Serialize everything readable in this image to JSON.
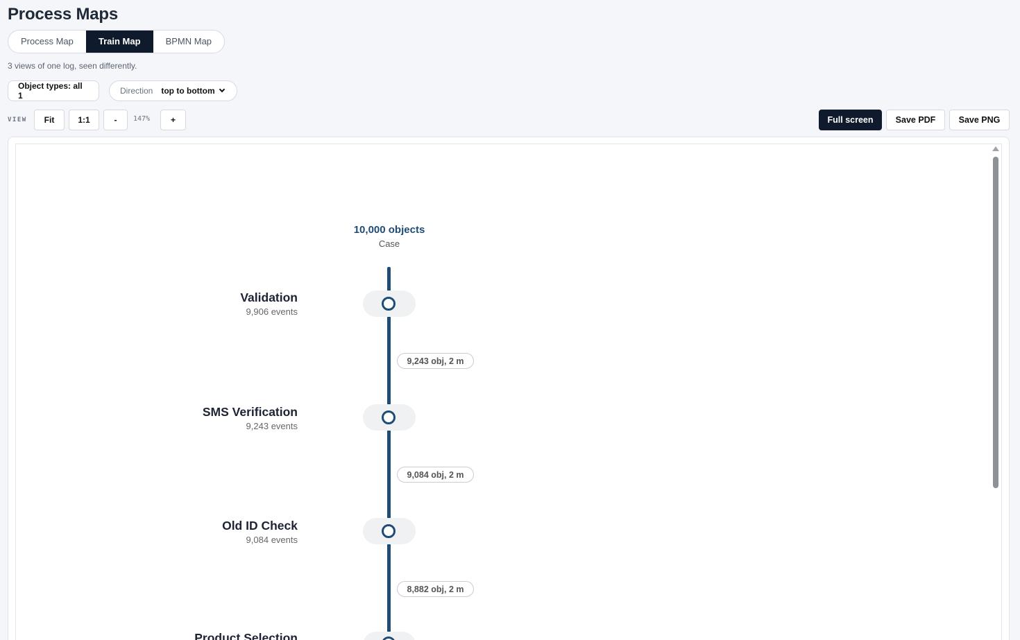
{
  "page": {
    "title": "Process Maps",
    "subtitle": "3 views of one log, seen differently."
  },
  "tabs": [
    {
      "label": "Process Map",
      "active": false
    },
    {
      "label": "Train Map",
      "active": true
    },
    {
      "label": "BPMN Map",
      "active": false
    }
  ],
  "filters": {
    "object_types": "Object types: all 1",
    "direction_label": "Direction",
    "direction_value": "top to bottom"
  },
  "view": {
    "label": "VIEW",
    "fit": "Fit",
    "one_to_one": "1:1",
    "zoom_out": "-",
    "zoom_level": "147%",
    "zoom_in": "+"
  },
  "actions": {
    "fullscreen": "Full screen",
    "save_pdf": "Save PDF",
    "save_png": "Save PNG"
  },
  "train": {
    "start": {
      "count": "10,000 objects",
      "type": "Case"
    },
    "activities": [
      {
        "name": "Validation",
        "events": "9,906 events"
      },
      {
        "name": "SMS Verification",
        "events": "9,243 events"
      },
      {
        "name": "Old ID Check",
        "events": "9,084 events"
      },
      {
        "name": "Product Selection",
        "events": ""
      }
    ],
    "edges": [
      {
        "label": "9,243 obj, 2 m"
      },
      {
        "label": "9,084 obj, 2 m"
      },
      {
        "label": "8,882 obj, 2 m"
      }
    ]
  },
  "colors": {
    "accent": "#1f4b77",
    "dark": "#0f1b2d",
    "background": "#f4f6f9"
  }
}
